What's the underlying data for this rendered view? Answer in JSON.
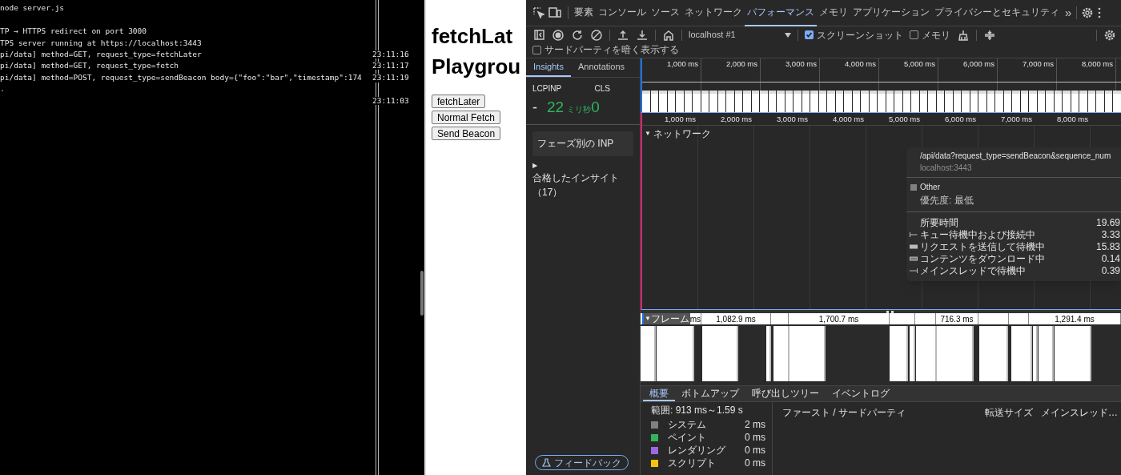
{
  "terminal": {
    "lines": [
      {
        "text": "node server.js"
      },
      {
        "text": "TP → HTTPS redirect on port 3000",
        "kind": "after-blank"
      },
      {
        "text": "TPS server running at https://localhost:3443"
      },
      {
        "text": "pi/data] method=GET, request_type=fetchLater",
        "time": "23:11:16"
      },
      {
        "text": "pi/data] method=GET, request_type=fetch",
        "time": "23:11:17"
      },
      {
        "text": "pi/data] method=POST, request_type=sendBeacon body={\"foo\":\"bar\",\"timestamp\":174",
        "time": "23:11:19"
      },
      {
        "text": "."
      },
      {
        "time": "23:11:03"
      }
    ]
  },
  "page": {
    "heading_lines": [
      "fetchLat",
      "Playgrou"
    ],
    "buttons": [
      "fetchLater",
      "Normal Fetch",
      "Send Beacon"
    ]
  },
  "devtools": {
    "tabs": [
      {
        "label": "要素",
        "selected": false
      },
      {
        "label": "コンソール",
        "selected": false
      },
      {
        "label": "ソース",
        "selected": false
      },
      {
        "label": "ネットワーク",
        "selected": false
      },
      {
        "label": "パフォーマンス",
        "selected": true
      },
      {
        "label": "メモリ",
        "selected": false
      },
      {
        "label": "アプリケーション",
        "selected": false
      },
      {
        "label": "プライバシーとセキュリティ",
        "selected": false
      }
    ],
    "more_tabs": "»",
    "target": "localhost #1",
    "options": [
      {
        "label": "スクリーンショット",
        "checked": true
      },
      {
        "label": "メモリ",
        "checked": false
      }
    ],
    "third_party": {
      "label": "サードパーティを暗く表示する",
      "checked": false
    },
    "sidebar": {
      "tabs": [
        {
          "label": "Insights",
          "selected": true
        },
        {
          "label": "Annotations",
          "selected": false
        }
      ],
      "metric_labels": [
        "LCP",
        "INP",
        "CLS"
      ],
      "lcp": "-",
      "inp": "22",
      "inp_unit": "ミリ秒",
      "cls": "0",
      "inp_card": "フェーズ別の INP",
      "expander": "▶",
      "passed": "合格したインサイト（17）",
      "feedback": "フィードバック"
    },
    "overview_ticks": [
      "1,000 ms",
      "2,000 ms",
      "3,000 ms",
      "4,000 ms",
      "5,000 ms",
      "6,000 ms",
      "7,000 ms",
      "8,000 ms"
    ],
    "ruler_ticks": [
      "1,000 ms",
      "2,000 ms",
      "3,000 ms",
      "4,000 ms",
      "5,000 ms",
      "6,000 ms",
      "7,000 ms",
      "8,000 ms"
    ],
    "track_expander": "▼",
    "network_track": "ネットワーク",
    "tooltip": {
      "url": "/api/data?request_type=sendBeacon&sequence_num",
      "host": "localhost:3443",
      "type": "Other",
      "priority": "優先度: 最低",
      "rows": [
        {
          "kind": "total",
          "label": "所要時間",
          "value": "19.69"
        },
        {
          "kind": "whisker",
          "label": "キュー待機中および接続中",
          "value": "3.33"
        },
        {
          "kind": "bar",
          "label": "リクエストを送信して待機中",
          "value": "15.83"
        },
        {
          "kind": "outline",
          "label": "コンテンツをダウンロード中",
          "value": "0.14"
        },
        {
          "kind": "end",
          "label": "メインスレッドで待機中",
          "value": "0.39"
        }
      ]
    },
    "frames": {
      "expander": "▼",
      "label": "フレーム",
      "durations": [
        "ms",
        "1,082.9 ms",
        "1,700.7 ms",
        "716.3 ms",
        "1,291.4 ms"
      ]
    },
    "bottom_tabs": [
      {
        "label": "概要",
        "selected": true
      },
      {
        "label": "ボトムアップ",
        "selected": false
      },
      {
        "label": "呼び出しツリー",
        "selected": false
      },
      {
        "label": "イベントログ",
        "selected": false
      }
    ],
    "summary": {
      "range": "範囲: 913 ms～1.59 s",
      "categories": [
        {
          "name": "システム",
          "value": "2 ms",
          "color": "#808080"
        },
        {
          "name": "ペイント",
          "value": "0 ms",
          "color": "#34b35a"
        },
        {
          "name": "レンダリング",
          "value": "0 ms",
          "color": "#a065e6"
        },
        {
          "name": "スクリプト",
          "value": "0 ms",
          "color": "#f4c20d"
        }
      ]
    },
    "table_columns": [
      "ファースト / サードパーティ",
      "転送サイズ",
      "メインスレッド…"
    ]
  }
}
